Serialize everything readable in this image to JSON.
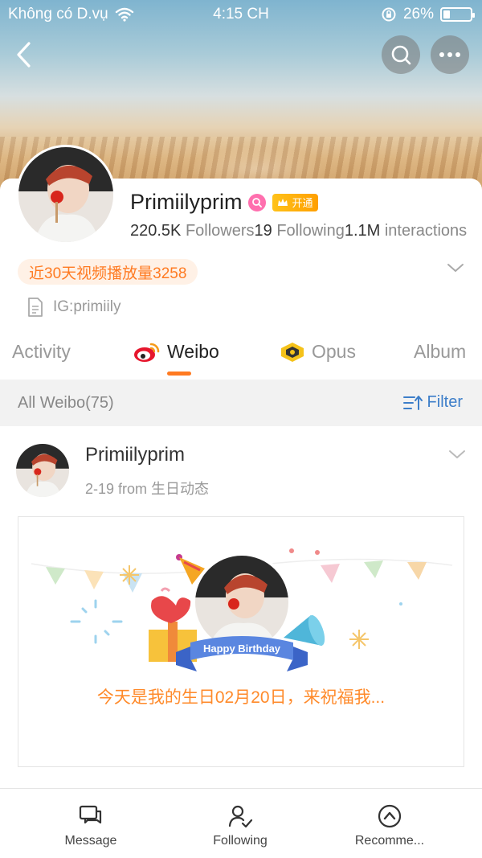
{
  "status": {
    "carrier": "Không có D.vụ",
    "time": "4:15 CH",
    "battery_percent": "26%",
    "battery_level": 0.26
  },
  "profile": {
    "name": "Primiilyprim",
    "vip_label": "开通",
    "followers_count": "220.5K",
    "followers_label": "Followers",
    "following_count": "19",
    "following_label": "Following",
    "interactions_count": "1.1M",
    "interactions_label": "interactions",
    "views_pill": "近30天视频播放量3258",
    "bio": "IG:primiily"
  },
  "tabs": [
    {
      "label": "Activity"
    },
    {
      "label": "Weibo"
    },
    {
      "label": "Opus"
    },
    {
      "label": "Album"
    }
  ],
  "feed": {
    "count_label": "All Weibo(75)",
    "filter_label": "Filter"
  },
  "post": {
    "author": "Primiilyprim",
    "meta": "2-19  from 生日动态",
    "banner_text": "Happy Birthday",
    "caption": "今天是我的生日02月20日，来祝福我..."
  },
  "bottom_nav": [
    {
      "label": "Message",
      "icon": "message-icon"
    },
    {
      "label": "Following",
      "icon": "user-check-icon"
    },
    {
      "label": "Recomme...",
      "icon": "compass-icon"
    }
  ],
  "colors": {
    "accent_orange": "#ff7a21",
    "link_blue": "#3d7ec9",
    "vip_gold": "#ffb000"
  }
}
